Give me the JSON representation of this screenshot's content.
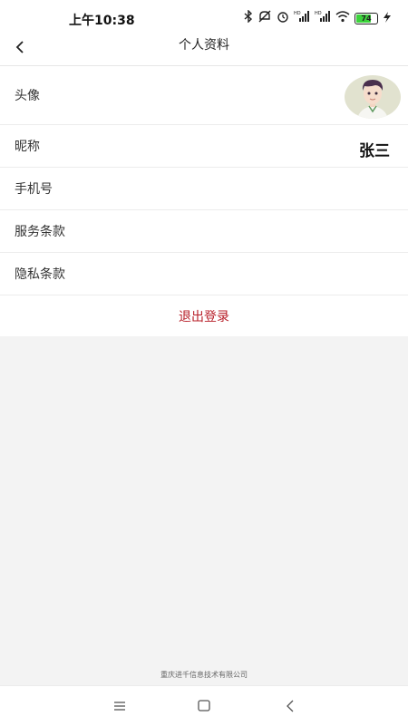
{
  "status_bar": {
    "time": "上午10:38",
    "battery": "74",
    "battery_level": 0.74,
    "network_label": "HD",
    "icons": [
      "bluetooth-icon",
      "mute-icon",
      "alarm-icon",
      "signal-icon",
      "signal-icon",
      "wifi-icon",
      "battery-icon",
      "charging-icon"
    ]
  },
  "header": {
    "back_icon": "chevron-left-icon",
    "title": "个人资料"
  },
  "profile": {
    "avatar_label": "头像",
    "nickname_label": "昵称",
    "nickname_value": "张三",
    "phone_label": "手机号",
    "terms_label": "服务条款",
    "privacy_label": "隐私条款",
    "logout_label": "退出登录"
  },
  "footer": {
    "company": "重庆进千信息技术有限公司"
  },
  "system_nav": {
    "icons": [
      "menu-icon",
      "home-icon",
      "back-icon"
    ]
  },
  "colors": {
    "logout": "#b8202a",
    "background": "#f3f3f3",
    "battery": "#3bd33b"
  }
}
